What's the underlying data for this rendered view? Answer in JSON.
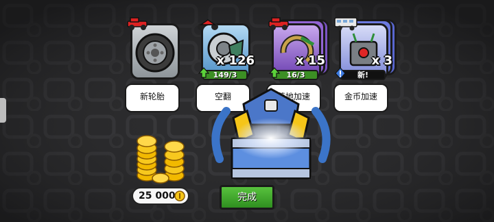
{
  "rewards": [
    {
      "label": "新轮胎",
      "item_icon": "tire-icon",
      "vehicle_icon": "jeep-icon",
      "rarity_color": "#b8bcc0",
      "count": "",
      "progress": "",
      "new": ""
    },
    {
      "label": "空翻",
      "item_icon": "flip-part-icon",
      "vehicle_icon": "motorbike-icon",
      "rarity_color": "#6fb0e0",
      "count": "x 126",
      "progress": "149/3",
      "new": ""
    },
    {
      "label": "落地加速",
      "item_icon": "landing-boost-icon",
      "vehicle_icon": "jeep-icon",
      "rarity_color": "#a97be0",
      "count": "x 15",
      "progress": "16/3",
      "new": ""
    },
    {
      "label": "金币加速",
      "item_icon": "coin-boost-icon",
      "vehicle_icon": "bus-icon",
      "rarity_color": "#7a86e8",
      "count": "x 3",
      "progress": "",
      "new": "新!"
    }
  ],
  "coins": {
    "amount": "25 000"
  },
  "done_label": "完成",
  "colors": {
    "progress_green": "#3c8f24",
    "done_green": "#3fa92b",
    "coin_gold": "#f5c518"
  }
}
